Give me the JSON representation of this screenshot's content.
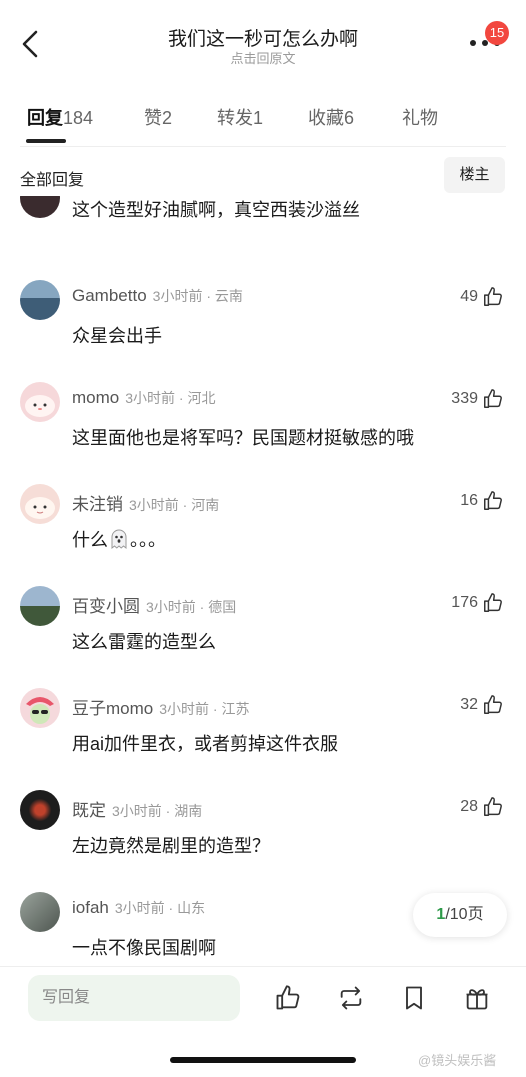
{
  "header": {
    "title": "我们这一秒可怎么办啊",
    "subtitle": "点击回原文",
    "notification_count": "15"
  },
  "tabs": [
    {
      "label": "回复",
      "count": "184",
      "active": true
    },
    {
      "label": "赞",
      "count": "2"
    },
    {
      "label": "转发",
      "count": "1"
    },
    {
      "label": "收藏",
      "count": "6"
    },
    {
      "label": "礼物",
      "count": ""
    }
  ],
  "section": {
    "title": "全部回复",
    "owner_filter": "楼主"
  },
  "comments": [
    {
      "name": "",
      "time": "",
      "location": "",
      "likes": "",
      "text": "这个造型好油腻啊，真空西装沙溢丝",
      "avatar_color": "#3a2b2e"
    },
    {
      "name": "Gambetto",
      "time": "3小时前",
      "location": "云南",
      "likes": "49",
      "text": "众星会出手",
      "avatar_color": "#5c7f9a"
    },
    {
      "name": "momo",
      "time": "3小时前",
      "location": "河北",
      "likes": "339",
      "text": "这里面他也是将军吗？民国题材挺敏感的哦",
      "avatar_color": "#f6d8da"
    },
    {
      "name": "未注销",
      "time": "3小时前",
      "location": "河南",
      "likes": "16",
      "text": "什么",
      "text_suffix": "。。。",
      "avatar_color": "#f6ddd7"
    },
    {
      "name": "百变小圆",
      "time": "3小时前",
      "location": "德国",
      "likes": "176",
      "text": "这么雷霆的造型么",
      "avatar_color": "#6d89a8"
    },
    {
      "name": "豆子momo",
      "time": "3小时前",
      "location": "江苏",
      "likes": "32",
      "text": "用ai加件里衣，或者剪掉这件衣服",
      "avatar_color": "#e8566a"
    },
    {
      "name": "既定",
      "time": "3小时前",
      "location": "湖南",
      "likes": "28",
      "text": "左边竟然是剧里的造型？",
      "avatar_color": "#1d1d1d"
    },
    {
      "name": "iofah",
      "time": "3小时前",
      "location": "山东",
      "likes": "",
      "text": "一点不像民国剧啊",
      "avatar_color": "#77807a"
    }
  ],
  "pager": {
    "current": "1",
    "total_text": "/10页"
  },
  "bottom": {
    "reply_placeholder": "写回复"
  },
  "watermark": "@镜头娱乐酱"
}
